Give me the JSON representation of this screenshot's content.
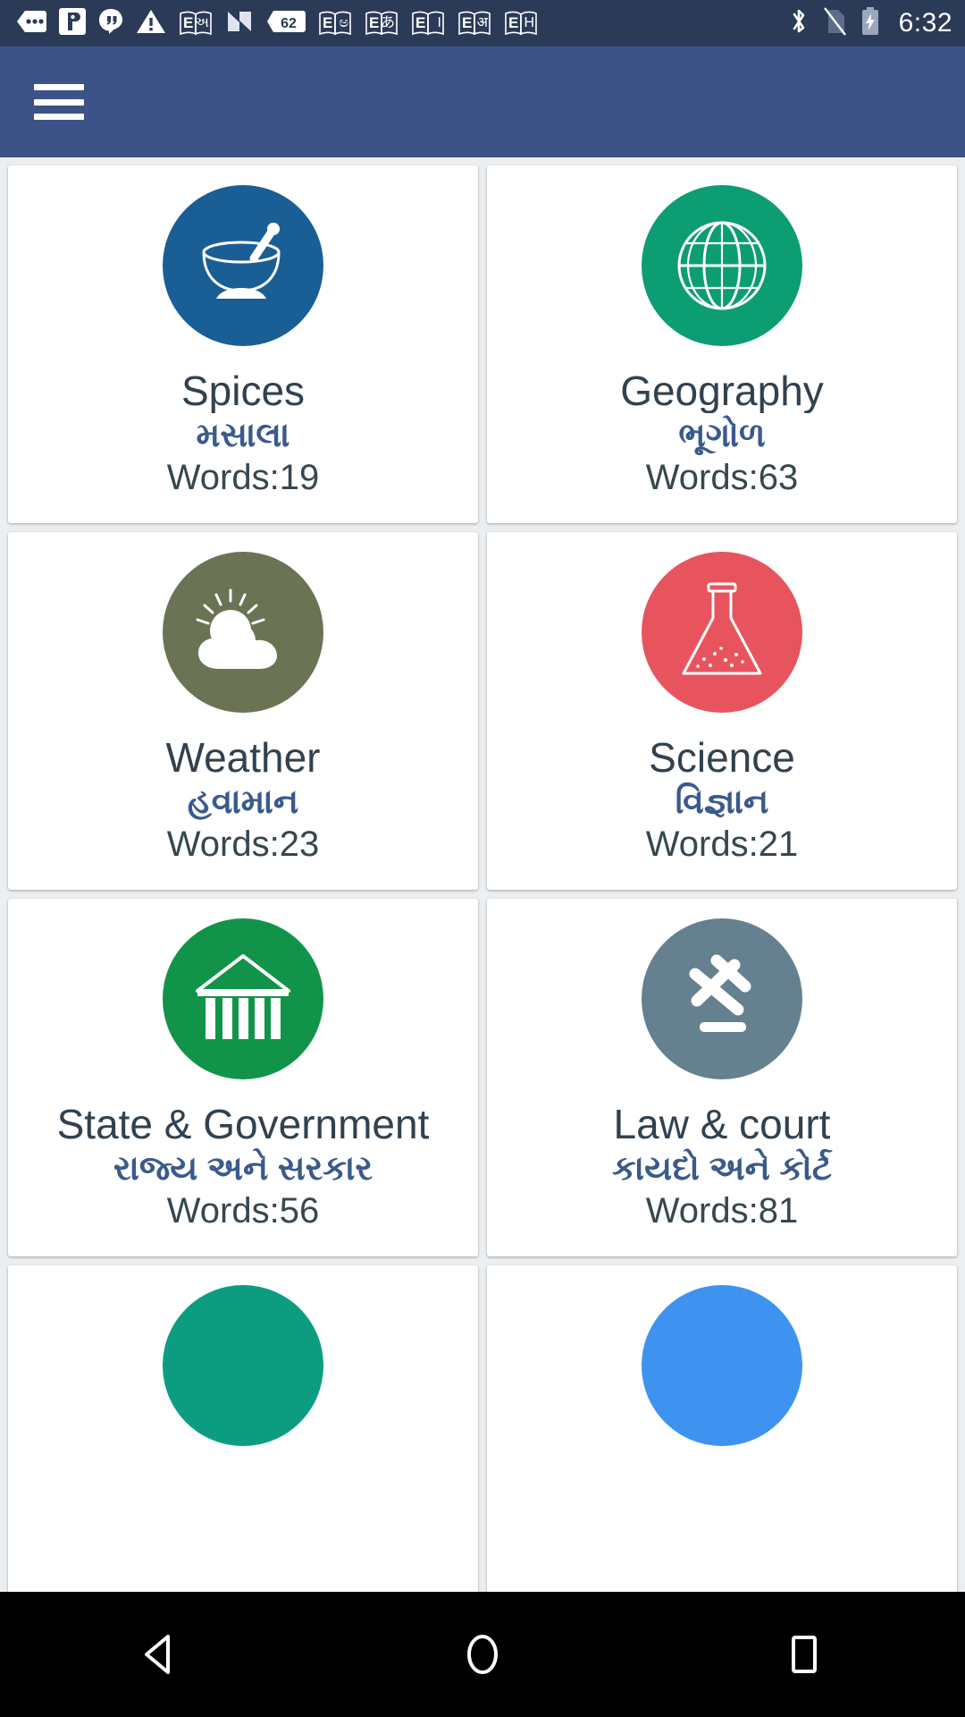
{
  "status_bar": {
    "time": "6:32",
    "left_icons": [
      {
        "name": "messages-icon"
      },
      {
        "name": "app-notification-icon"
      },
      {
        "name": "hangouts-icon"
      },
      {
        "name": "warning-icon"
      },
      {
        "name": "dict-gujarati-icon",
        "left": "E",
        "right": "અ"
      },
      {
        "name": "nougat-icon"
      },
      {
        "name": "badge-62-icon",
        "label": "62"
      },
      {
        "name": "dict-kannada-icon",
        "left": "E",
        "right": "ಅ"
      },
      {
        "name": "dict-japanese-icon",
        "left": "E",
        "right": "あ"
      },
      {
        "name": "dict-italian-icon",
        "left": "E",
        "right": "I"
      },
      {
        "name": "dict-hindi-icon",
        "left": "E",
        "right": "अ"
      },
      {
        "name": "dict-hungarian-icon",
        "left": "E",
        "right": "H"
      }
    ],
    "right_icons": [
      {
        "name": "bluetooth-icon"
      },
      {
        "name": "sim-missing-icon"
      },
      {
        "name": "battery-charging-icon"
      }
    ]
  },
  "app_bar": {
    "menu_label": "Menu",
    "background": "#3b5387"
  },
  "colors": {
    "status_bar_bg": "#2b3a57",
    "app_bar_bg": "#3b5387",
    "page_bg": "#eceff1",
    "card_bg": "#ffffff",
    "title_text": "#31414f",
    "subtitle_text": "#3a5a8c",
    "words_text": "#37474f"
  },
  "grid": {
    "words_prefix": "Words:",
    "cards": [
      {
        "id": "spices",
        "title": "Spices",
        "subtitle": "મસાલા",
        "words": "Words:19",
        "count": 19,
        "icon": "mortar-pestle-icon",
        "color": "#1a5e96"
      },
      {
        "id": "geography",
        "title": "Geography",
        "subtitle": "ભૂગોળ",
        "words": "Words:63",
        "count": 63,
        "icon": "globe-icon",
        "color": "#0d9d72"
      },
      {
        "id": "weather",
        "title": "Weather",
        "subtitle": "હવામાન",
        "words": "Words:23",
        "count": 23,
        "icon": "sun-cloud-icon",
        "color": "#6b7355"
      },
      {
        "id": "science",
        "title": "Science",
        "subtitle": "વિજ્ઞાન",
        "words": "Words:21",
        "count": 21,
        "icon": "flask-icon",
        "color": "#e8545e"
      },
      {
        "id": "state-government",
        "title": "State & Government",
        "subtitle": "રાજ્ય અને સરકાર",
        "words": "Words:56",
        "count": 56,
        "icon": "government-building-icon",
        "color": "#119449"
      },
      {
        "id": "law-court",
        "title": "Law & court",
        "subtitle": "કાયદો અને કોર્ટ",
        "words": "Words:81",
        "count": 81,
        "icon": "gavel-icon",
        "color": "#65808f"
      },
      {
        "id": "partial-left",
        "title": "",
        "subtitle": "",
        "words": "",
        "count": null,
        "icon": "partial-icon",
        "color": "#0c9d80"
      },
      {
        "id": "partial-right",
        "title": "",
        "subtitle": "",
        "words": "",
        "count": null,
        "icon": "partial-icon",
        "color": "#3f93f0"
      }
    ]
  },
  "nav_bar": {
    "back_label": "Back",
    "home_label": "Home",
    "recents_label": "Recents"
  }
}
